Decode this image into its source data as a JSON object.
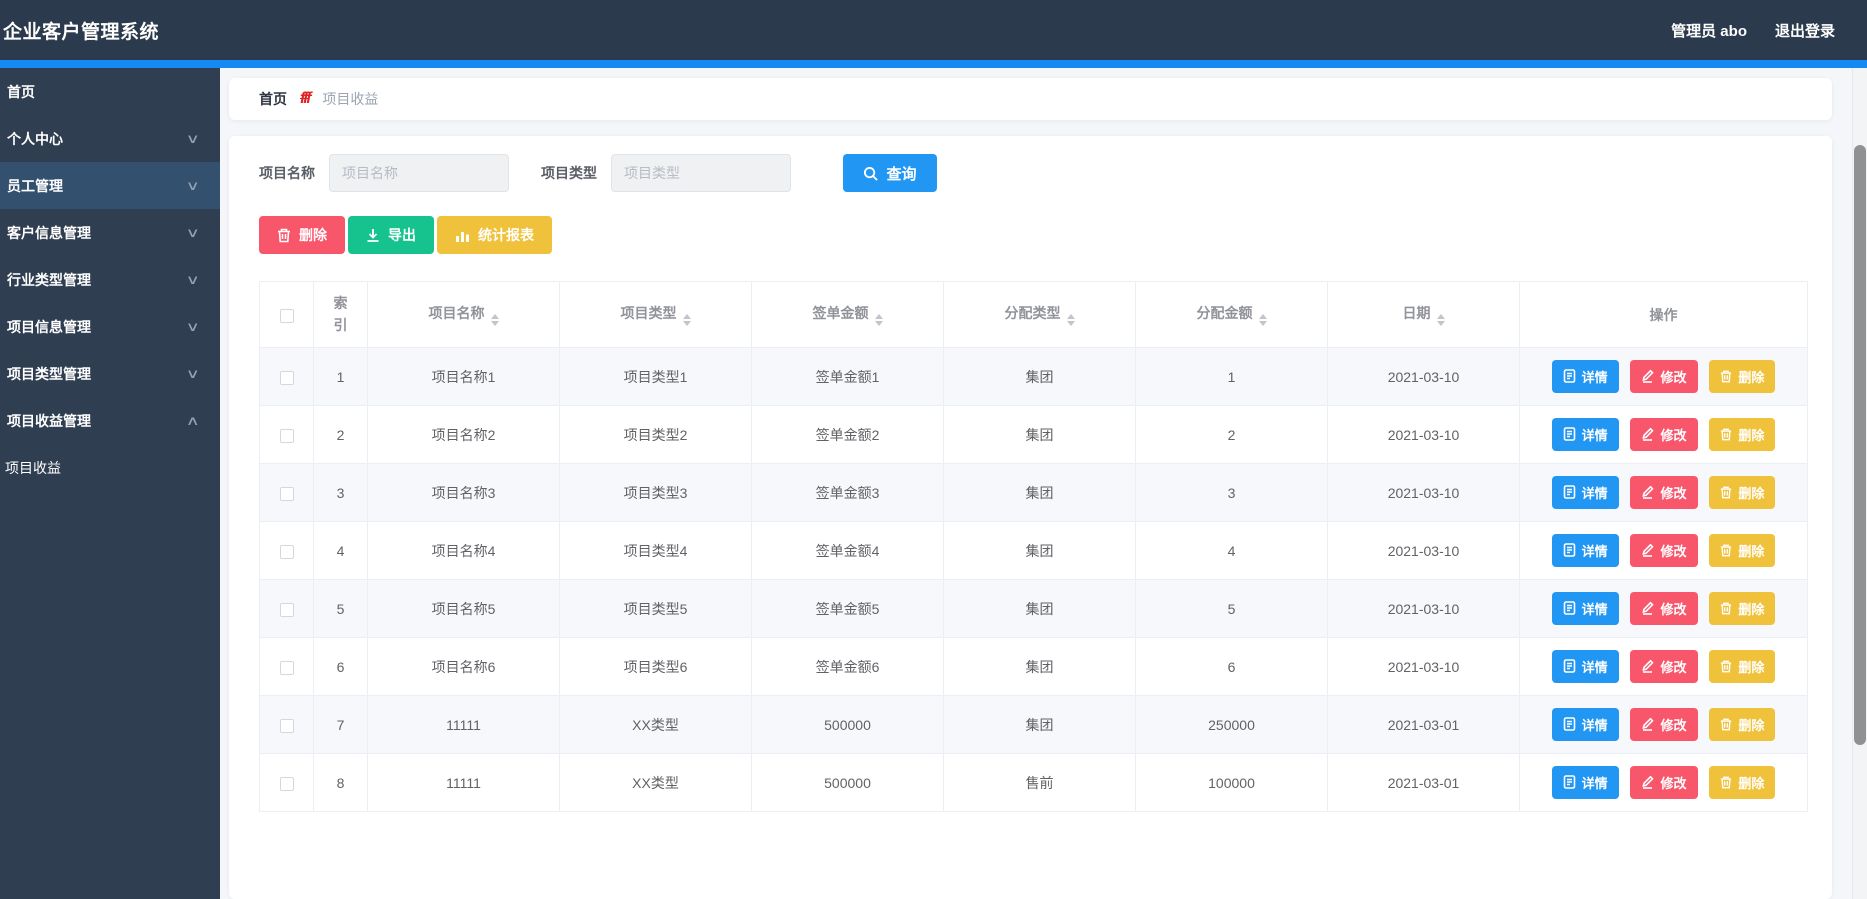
{
  "app": {
    "title": "企业客户管理系统",
    "user": "管理员 abo",
    "logout": "退出登录"
  },
  "colors": {
    "topbar_bg": "#2b3a4c",
    "strip_blue": "#1789f2",
    "sidebar_bg": "#2f3e51",
    "sidebar_active_bg": "#33506e",
    "primary_blue": "#2196f3",
    "danger_red": "#f8566b",
    "success_green": "#16c28e",
    "warning_yellow": "#f0c23c"
  },
  "sidebar": {
    "items": [
      {
        "label": "首页",
        "chevron": "",
        "state": ""
      },
      {
        "label": "个人中心",
        "chevron": "∨",
        "state": ""
      },
      {
        "label": "员工管理",
        "chevron": "∨",
        "state": "active"
      },
      {
        "label": "客户信息管理",
        "chevron": "∨",
        "state": ""
      },
      {
        "label": "行业类型管理",
        "chevron": "∨",
        "state": ""
      },
      {
        "label": "项目信息管理",
        "chevron": "∨",
        "state": ""
      },
      {
        "label": "项目类型管理",
        "chevron": "∨",
        "state": ""
      },
      {
        "label": "项目收益管理",
        "chevron": "∧",
        "state": ""
      },
      {
        "label": "项目收益",
        "chevron": "",
        "state": "submenu"
      }
    ]
  },
  "breadcrumb": {
    "home": "首页",
    "separator": "fff",
    "current": "项目收益"
  },
  "search": {
    "name_label": "项目名称",
    "name_placeholder": "项目名称",
    "type_label": "项目类型",
    "type_placeholder": "项目类型",
    "query": "查询"
  },
  "toolbar": {
    "delete": "删除",
    "export": "导出",
    "report": "统计报表"
  },
  "table": {
    "columns": [
      {
        "key": "checkbox",
        "label": ""
      },
      {
        "key": "index",
        "label": "索引"
      },
      {
        "key": "name",
        "label": "项目名称"
      },
      {
        "key": "type",
        "label": "项目类型"
      },
      {
        "key": "sign_amount",
        "label": "签单金额"
      },
      {
        "key": "alloc_type",
        "label": "分配类型"
      },
      {
        "key": "alloc_amount",
        "label": "分配金额"
      },
      {
        "key": "date",
        "label": "日期"
      },
      {
        "key": "ops",
        "label": "操作"
      }
    ],
    "rows": [
      {
        "index": "1",
        "name": "项目名称1",
        "type": "项目类型1",
        "sign_amount": "签单金额1",
        "alloc_type": "集团",
        "alloc_amount": "1",
        "date": "2021-03-10"
      },
      {
        "index": "2",
        "name": "项目名称2",
        "type": "项目类型2",
        "sign_amount": "签单金额2",
        "alloc_type": "集团",
        "alloc_amount": "2",
        "date": "2021-03-10"
      },
      {
        "index": "3",
        "name": "项目名称3",
        "type": "项目类型3",
        "sign_amount": "签单金额3",
        "alloc_type": "集团",
        "alloc_amount": "3",
        "date": "2021-03-10"
      },
      {
        "index": "4",
        "name": "项目名称4",
        "type": "项目类型4",
        "sign_amount": "签单金额4",
        "alloc_type": "集团",
        "alloc_amount": "4",
        "date": "2021-03-10"
      },
      {
        "index": "5",
        "name": "项目名称5",
        "type": "项目类型5",
        "sign_amount": "签单金额5",
        "alloc_type": "集团",
        "alloc_amount": "5",
        "date": "2021-03-10"
      },
      {
        "index": "6",
        "name": "项目名称6",
        "type": "项目类型6",
        "sign_amount": "签单金额6",
        "alloc_type": "集团",
        "alloc_amount": "6",
        "date": "2021-03-10"
      },
      {
        "index": "7",
        "name": "11111",
        "type": "XX类型",
        "sign_amount": "500000",
        "alloc_type": "集团",
        "alloc_amount": "250000",
        "date": "2021-03-01"
      },
      {
        "index": "8",
        "name": "11111",
        "type": "XX类型",
        "sign_amount": "500000",
        "alloc_type": "售前",
        "alloc_amount": "100000",
        "date": "2021-03-01"
      }
    ],
    "row_actions": {
      "detail": "详情",
      "edit": "修改",
      "delete": "删除"
    }
  }
}
